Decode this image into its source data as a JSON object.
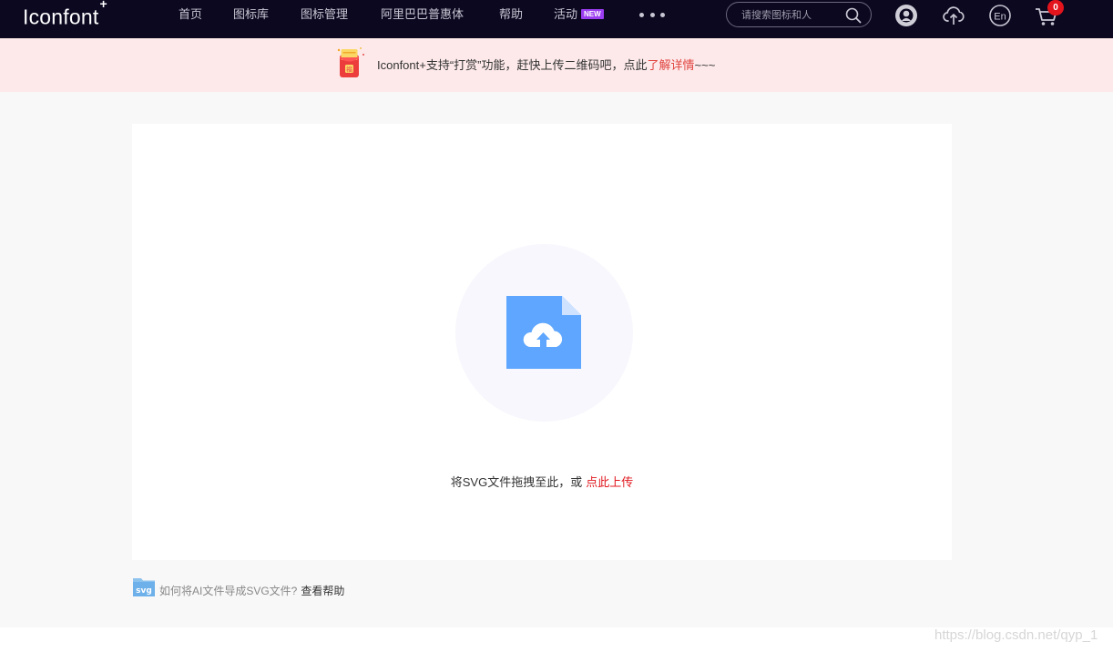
{
  "header": {
    "logo": "Iconfont",
    "logo_mark": "+",
    "nav": [
      "首页",
      "图标库",
      "图标管理",
      "阿里巴巴普惠体",
      "帮助",
      "活动"
    ],
    "new_badge": "NEW",
    "search": {
      "placeholder": "请搜索图标和人"
    },
    "cart_count": "0",
    "icons": {
      "more": "more-dots-icon",
      "search": "search-icon",
      "user": "user-avatar-icon",
      "upload": "cloud-upload-icon",
      "language": "language-en-icon",
      "cart": "cart-icon"
    }
  },
  "notice": {
    "text": "Iconfont+支持“打赏”功能，赶快上传二维码吧，点此",
    "link": "了解详情",
    "suffix": "~~~",
    "icon": "red-envelope-icon"
  },
  "upload": {
    "drop_text": "将SVG文件拖拽至此，或",
    "upload_link": "点此上传",
    "icon": "file-upload-icon"
  },
  "help": {
    "question": "如何将AI文件导成SVG文件?",
    "link": "查看帮助",
    "icon_label": "svg"
  },
  "watermark": "https://blog.csdn.net/qyp_1",
  "colors": {
    "nav_bg": "#0b0820",
    "notice_bg": "#fde9ea",
    "accent_red": "#e0181f",
    "file_blue": "#5ea6ff",
    "badge_purple": "#9b3df0"
  }
}
